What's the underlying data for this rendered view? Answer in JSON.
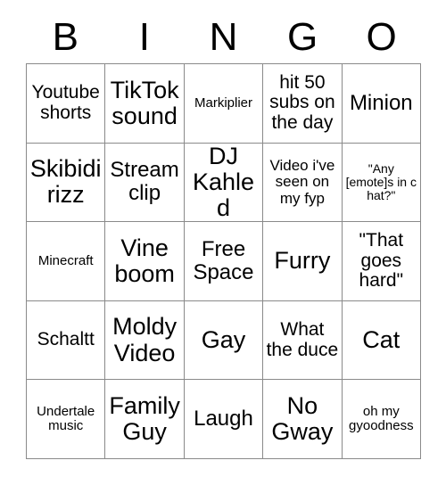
{
  "card": {
    "header_letters": [
      "B",
      "I",
      "N",
      "G",
      "O"
    ],
    "columns": 5,
    "rows": 5,
    "border_color": "#8a8a8a",
    "cell_background": "#ffffff",
    "text_color": "#000000",
    "cells": [
      {
        "text": "Youtube shorts",
        "size": "fs-md",
        "row": 1,
        "col": 1
      },
      {
        "text": "TikTok sound",
        "size": "fs-xl",
        "row": 1,
        "col": 2
      },
      {
        "text": "Markiplier",
        "size": "fs-xs",
        "row": 1,
        "col": 3
      },
      {
        "text": "hit 50 subs on the day",
        "size": "fs-md",
        "row": 1,
        "col": 4
      },
      {
        "text": "Minion",
        "size": "fs-lg",
        "row": 1,
        "col": 5
      },
      {
        "text": "Skibidi rizz",
        "size": "fs-xl",
        "row": 2,
        "col": 1
      },
      {
        "text": "Stream clip",
        "size": "fs-lg",
        "row": 2,
        "col": 2
      },
      {
        "text": "DJ Kahled",
        "size": "fs-xl",
        "row": 2,
        "col": 3
      },
      {
        "text": "Video i've seen on my fyp",
        "size": "fs-sm",
        "row": 2,
        "col": 4
      },
      {
        "text": "\"Any [emote]s in c hat?\"",
        "size": "fs-xxs",
        "row": 2,
        "col": 5
      },
      {
        "text": "Minecraft",
        "size": "fs-xs",
        "row": 3,
        "col": 1
      },
      {
        "text": "Vine boom",
        "size": "fs-xl",
        "row": 3,
        "col": 2
      },
      {
        "text": "Free Space",
        "size": "fs-lg",
        "row": 3,
        "col": 3
      },
      {
        "text": "Furry",
        "size": "fs-xl",
        "row": 3,
        "col": 4
      },
      {
        "text": "\"That goes hard\"",
        "size": "fs-md",
        "row": 3,
        "col": 5
      },
      {
        "text": "Schaltt",
        "size": "fs-md",
        "row": 4,
        "col": 1
      },
      {
        "text": "Moldy Video",
        "size": "fs-xl",
        "row": 4,
        "col": 2
      },
      {
        "text": "Gay",
        "size": "fs-xl",
        "row": 4,
        "col": 3
      },
      {
        "text": "What the duce",
        "size": "fs-md",
        "row": 4,
        "col": 4
      },
      {
        "text": "Cat",
        "size": "fs-xl",
        "row": 4,
        "col": 5
      },
      {
        "text": "Undertale music",
        "size": "fs-xs",
        "row": 5,
        "col": 1
      },
      {
        "text": "Family Guy",
        "size": "fs-xl",
        "row": 5,
        "col": 2
      },
      {
        "text": "Laugh",
        "size": "fs-lg",
        "row": 5,
        "col": 3
      },
      {
        "text": "No Gway",
        "size": "fs-xl",
        "row": 5,
        "col": 4
      },
      {
        "text": "oh my gyoodness",
        "size": "fs-xs",
        "row": 5,
        "col": 5
      }
    ]
  }
}
